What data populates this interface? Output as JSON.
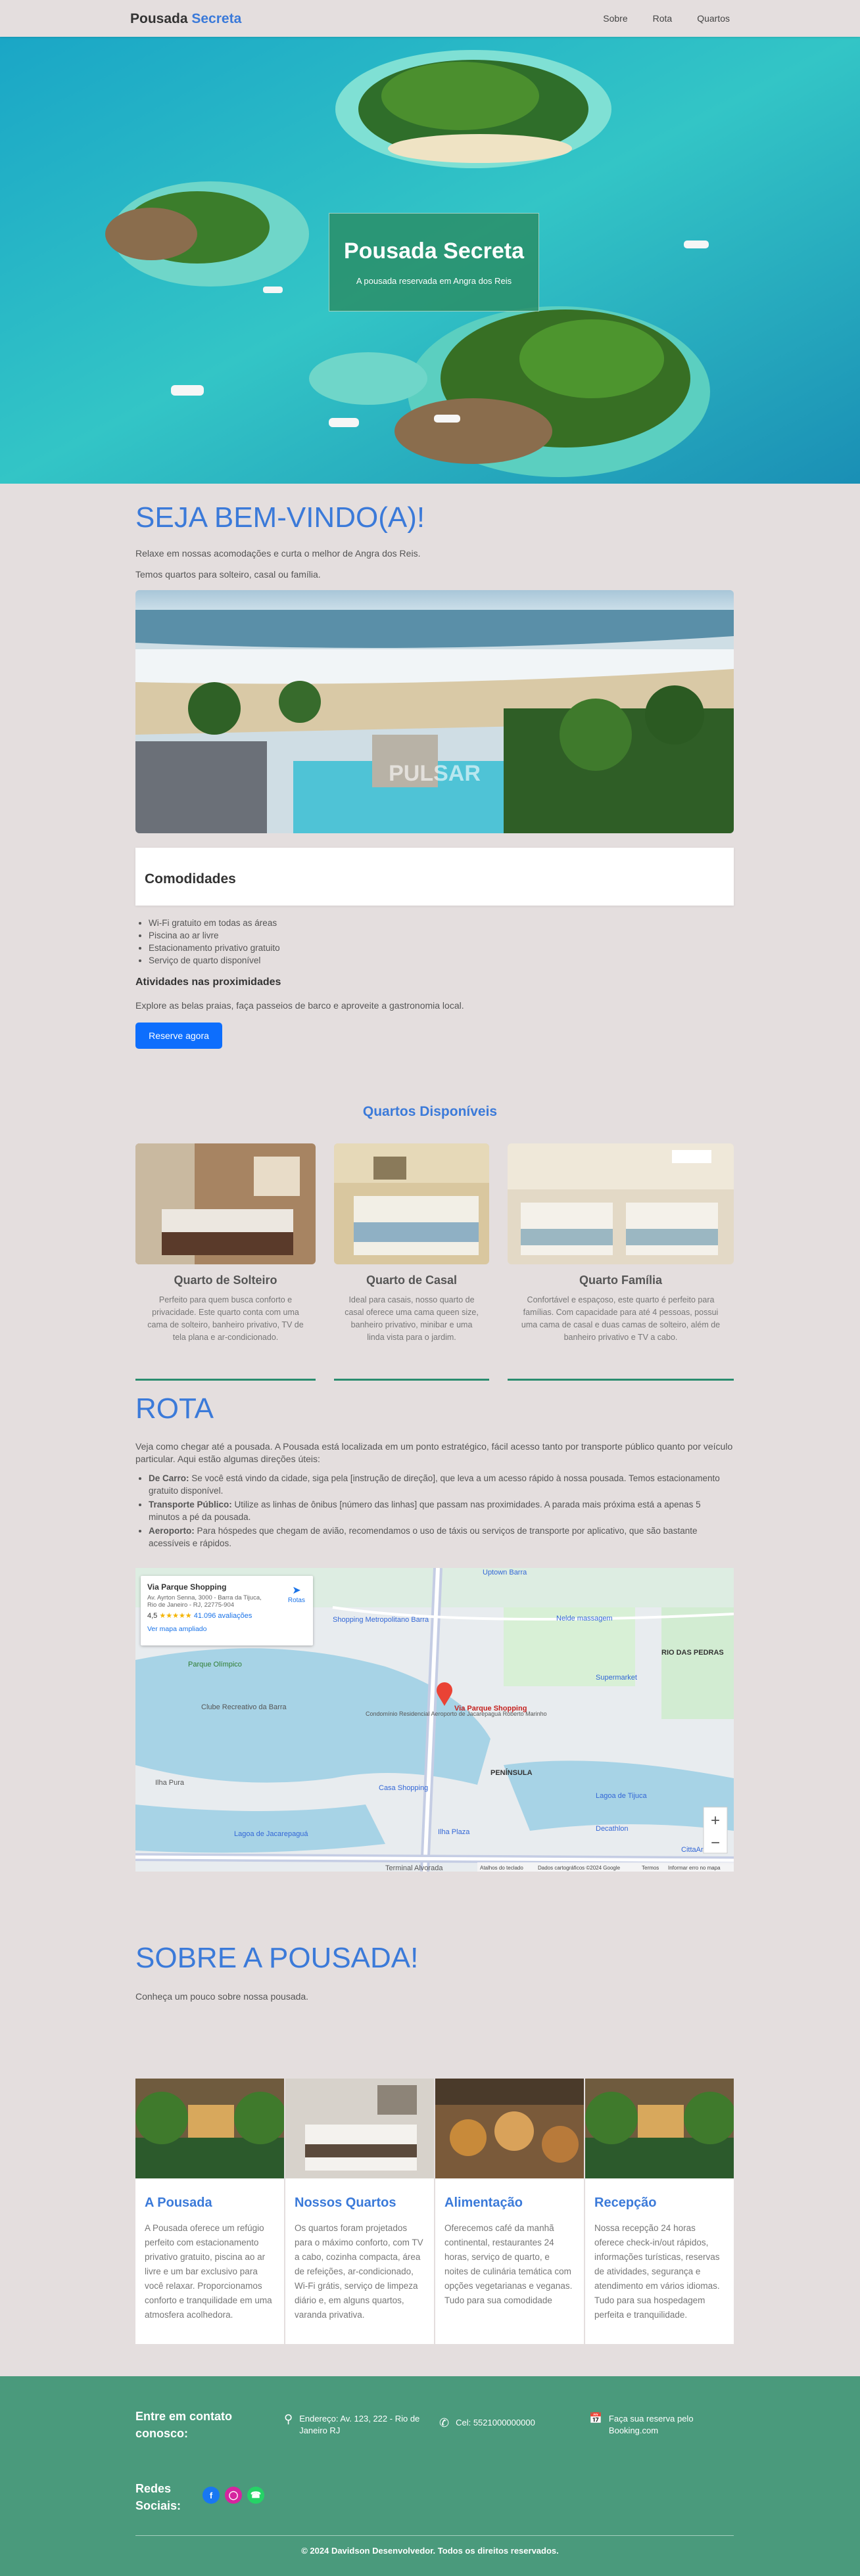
{
  "nav": {
    "brand_main": "Pousada ",
    "brand_accent": "Secreta",
    "links": [
      "Sobre",
      "Rota",
      "Quartos"
    ]
  },
  "hero": {
    "title": "Pousada Secreta",
    "subtitle": "A pousada reservada em Angra dos Reis"
  },
  "welcome": {
    "title": "SEJA BEM-VINDO(A)!",
    "p1": "Relaxe em nossas acomodações e curta o melhor de Angra dos Reis.",
    "p2": "Temos quartos para solteiro, casal ou família.",
    "watermark": "PULSAR"
  },
  "amenities": {
    "title": "Comodidades",
    "items": [
      "Wi-Fi gratuito em todas as áreas",
      "Piscina ao ar livre",
      "Estacionamento privativo gratuito",
      "Serviço de quarto disponível"
    ],
    "activities_title": "Atividades nas proximidades",
    "activities_text": "Explore as belas praias, faça passeios de barco e aproveite a gastronomia local.",
    "button": "Reserve agora"
  },
  "rooms": {
    "title": "Quartos Disponíveis",
    "items": [
      {
        "name": "Quarto de Solteiro",
        "desc": "Perfeito para quem busca conforto e privacidade. Este quarto conta com uma cama de solteiro, banheiro privativo, TV de tela plana e ar-condicionado."
      },
      {
        "name": "Quarto de Casal",
        "desc": "Ideal para casais, nosso quarto de casal oferece uma cama queen size, banheiro privativo, minibar e uma linda vista para o jardim."
      },
      {
        "name": "Quarto Família",
        "desc": "Confortável e espaçoso, este quarto é perfeito para famílias. Com capacidade para até 4 pessoas, possui uma cama de casal e duas camas de solteiro, além de banheiro privativo e TV a cabo."
      }
    ]
  },
  "rota": {
    "title": "ROTA",
    "intro": "Veja como chegar até a pousada. A Pousada está localizada em um ponto estratégico, fácil acesso tanto por transporte público quanto por veículo particular. Aqui estão algumas direções úteis:",
    "items": [
      {
        "label": "De Carro:",
        "text": " Se você está vindo da cidade, siga pela [instrução de direção], que leva a um acesso rápido à nossa pousada. Temos estacionamento gratuito disponível."
      },
      {
        "label": "Transporte Público:",
        "text": " Utilize as linhas de ônibus [número das linhas] que passam nas proximidades. A parada mais próxima está a apenas 5 minutos a pé da pousada."
      },
      {
        "label": "Aeroporto:",
        "text": " Para hóspedes que chegam de avião, recomendamos o uso de táxis ou serviços de transporte por aplicativo, que são bastante acessíveis e rápidos."
      }
    ]
  },
  "map": {
    "place": "Via Parque Shopping",
    "address": "Av. Ayrton Senna, 3000 - Barra da Tijuca, Rio de Janeiro - RJ, 22775-904",
    "rating": "4,5",
    "stars": "★★★★★",
    "reviews": "41.096 avaliações",
    "link": "Ver mapa ampliado",
    "routes": "Rotas",
    "labels": [
      "Uptown Barra",
      "Shopping Metropolitano Barra",
      "Parque Olímpico",
      "Condomínio Residencial Aeroporto de Jacarepaguá Roberto Marinho",
      "Via Parque Shopping",
      "Casa Shopping",
      "PENÍNSULA",
      "RIO DAS PEDRAS",
      "Lagoa de Tijuca",
      "Lagoa de Jacarepaguá",
      "Nelde massagem",
      "Supermarket",
      "CittaAmerica",
      "Decathlon",
      "Terminal Alvorada",
      "Ilha Pura",
      "Clube Recreativo da Barra",
      "Ilha Plaza"
    ],
    "footer": [
      "Atalhos do teclado",
      "Dados cartográficos ©2024 Google",
      "Termos",
      "Informar erro no mapa"
    ],
    "zoom_in": "+",
    "zoom_out": "−"
  },
  "sobre": {
    "title": "SOBRE A POUSADA!",
    "subtitle": "Conheça um pouco sobre nossa pousada.",
    "features": [
      {
        "title": "A Pousada",
        "text": "A Pousada oferece um refúgio perfeito com estacionamento privativo gratuito, piscina ao ar livre e um bar exclusivo para você relaxar. Proporcionamos conforto e tranquilidade em uma atmosfera acolhedora."
      },
      {
        "title": "Nossos Quartos",
        "text": "Os quartos foram projetados para o máximo conforto, com TV a cabo, cozinha compacta, área de refeições, ar-condicionado, Wi-Fi grátis, serviço de limpeza diário e, em alguns quartos, varanda privativa."
      },
      {
        "title": "Alimentação",
        "text": "Oferecemos café da manhã continental, restaurantes 24 horas, serviço de quarto, e noites de culinária temática com opções vegetarianas e veganas. Tudo para sua comodidade"
      },
      {
        "title": "Recepção",
        "text": "Nossa recepção 24 horas oferece check-in/out rápidos, informações turísticas, reservas de atividades, segurança e atendimento em vários idiomas. Tudo para sua hospedagem perfeita e tranquilidade."
      }
    ]
  },
  "footer": {
    "contact_title": "Entre em contato conosco:",
    "address": "Endereço: Av. 123, 222 - Rio de Janeiro RJ",
    "phone": "Cel: 5521000000000",
    "booking": "Faça sua reserva pelo Booking.com",
    "social_title": "Redes Sociais:",
    "copyright": "© 2024 Davidson Desenvolvedor. Todos os direitos reservados."
  },
  "colors": {
    "accent": "#3b7ad9",
    "footer": "#4a9a7c",
    "button": "#0d6efd",
    "background": "#e4dede"
  }
}
